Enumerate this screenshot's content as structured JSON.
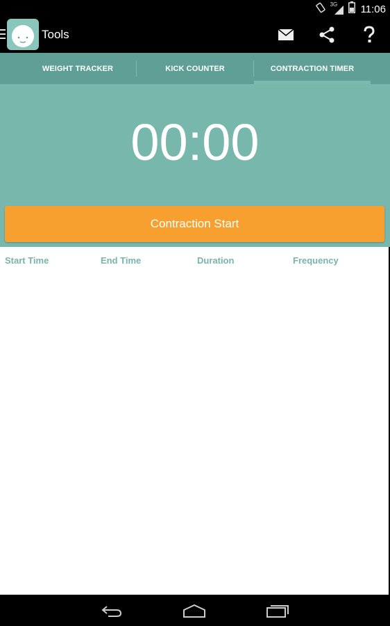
{
  "status_bar": {
    "time": "11:06",
    "network": "3G",
    "icons": [
      "rotate-icon",
      "signal-icon",
      "battery-icon"
    ]
  },
  "action_bar": {
    "title": "Tools",
    "icons": [
      "drawer-icon",
      "app-logo-icon",
      "mail-icon",
      "share-icon",
      "help-icon"
    ]
  },
  "tabs": [
    {
      "label": "WEIGHT TRACKER",
      "selected": false
    },
    {
      "label": "KICK COUNTER",
      "selected": false
    },
    {
      "label": "CONTRACTION TIMER",
      "selected": true
    }
  ],
  "timer": {
    "value": "00:00",
    "button_label": "Contraction Start"
  },
  "table": {
    "columns": [
      "Start Time",
      "End Time",
      "Duration",
      "Frequency"
    ],
    "rows": []
  },
  "navigation": {
    "icons": [
      "back-icon",
      "home-icon",
      "recent-apps-icon"
    ]
  },
  "colors": {
    "tab_bar": "#5f9f96",
    "timer_bg": "#78b7ac",
    "button": "#f7a030",
    "column_header": "#78b5a8"
  }
}
